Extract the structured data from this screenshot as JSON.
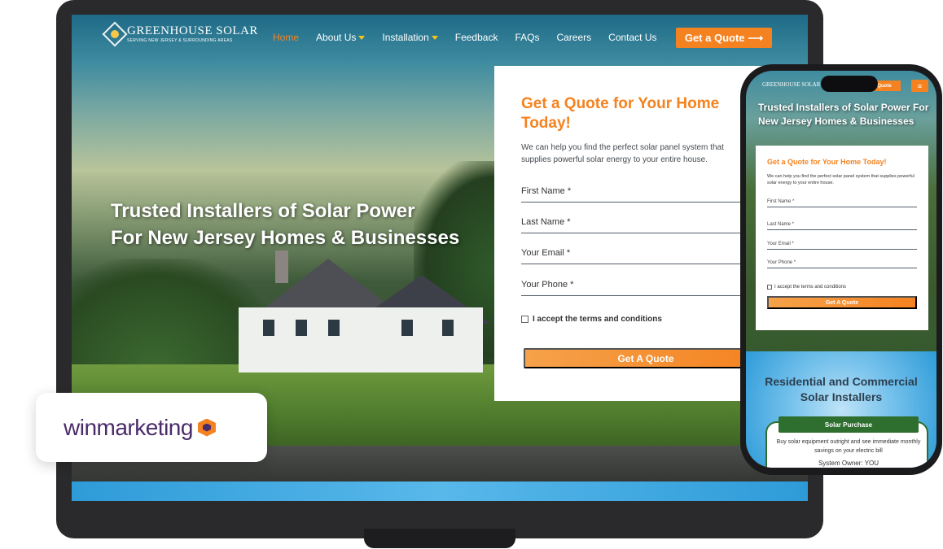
{
  "desktop": {
    "logo": {
      "title": "GREENHOUSE SOLAR",
      "subtitle": "SERVING NEW JERSEY & SURROUNDING AREAS"
    },
    "nav": [
      {
        "label": "Home",
        "active": true
      },
      {
        "label": "About Us",
        "dropdown": true
      },
      {
        "label": "Installation",
        "dropdown": true
      },
      {
        "label": "Feedback"
      },
      {
        "label": "FAQs"
      },
      {
        "label": "Careers"
      },
      {
        "label": "Contact Us"
      }
    ],
    "cta": {
      "label": "Get a Quote",
      "icon": "arrow-right-icon"
    },
    "hero": {
      "line1": "Trusted Installers of Solar Power",
      "line2": "For New Jersey Homes & Businesses"
    },
    "quote_form": {
      "title": "Get a Quote for Your Home Today!",
      "description": "We can help you find the perfect solar panel system that supplies powerful solar energy to your entire house.",
      "fields": [
        "First Name *",
        "Last Name *",
        "Your Email *",
        "Your Phone *"
      ],
      "terms": "I accept the terms and conditions",
      "submit": "Get A Quote"
    }
  },
  "badge": {
    "text": "winmarketing",
    "icon": "winmarketing-hex-logo"
  },
  "mobile": {
    "logo": "GREENHOUSE SOLAR",
    "cta": "Quote",
    "hero": "Trusted Installers of Solar Power For New Jersey Homes & Businesses",
    "quote_form": {
      "title": "Get a Quote for Your Home Today!",
      "description": "We can help you find the perfect solar panel system that supplies powerful solar energy to your entire house.",
      "fields": [
        "First Name *",
        "Last Name *",
        "Your Email *",
        "Your Phone *"
      ],
      "terms": "I accept the terms and conditions",
      "submit": "Get A Quote"
    },
    "section_title": "Residential and Commercial Solar Installers",
    "plan": {
      "tab": "Solar Purchase",
      "text": "Buy solar equipment outright and see immediate monthly savings on your electric bill",
      "owner": "System Owner: YOU"
    }
  },
  "colors": {
    "accent": "#f58220",
    "nav_caret": "#f5c518",
    "brand_purple": "#4a2b6a",
    "plan_green": "#2e6e2e"
  }
}
